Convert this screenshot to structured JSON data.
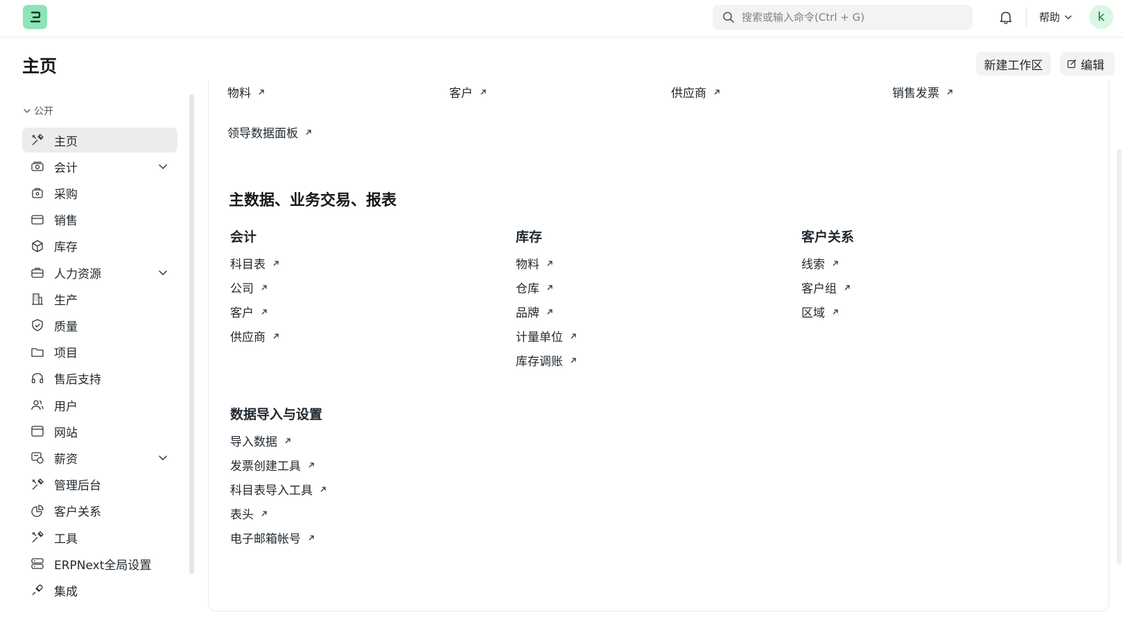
{
  "navbar": {
    "search_placeholder": "搜索或输入命令(Ctrl + G)",
    "help_label": "帮助",
    "avatar_letter": "k"
  },
  "page": {
    "title": "主页",
    "new_workspace_label": "新建工作区",
    "edit_label": "编辑"
  },
  "sidebar": {
    "section_label": "公开",
    "items": [
      {
        "label": "主页",
        "icon": "tools-icon",
        "active": true,
        "expandable": false
      },
      {
        "label": "会计",
        "icon": "money-icon",
        "active": false,
        "expandable": true
      },
      {
        "label": "采购",
        "icon": "purchase-icon",
        "active": false,
        "expandable": false
      },
      {
        "label": "销售",
        "icon": "card-icon",
        "active": false,
        "expandable": false
      },
      {
        "label": "库存",
        "icon": "box-icon",
        "active": false,
        "expandable": false
      },
      {
        "label": "人力资源",
        "icon": "briefcase-icon",
        "active": false,
        "expandable": true
      },
      {
        "label": "生产",
        "icon": "building-icon",
        "active": false,
        "expandable": false
      },
      {
        "label": "质量",
        "icon": "shield-icon",
        "active": false,
        "expandable": false
      },
      {
        "label": "项目",
        "icon": "folder-icon",
        "active": false,
        "expandable": false
      },
      {
        "label": "售后支持",
        "icon": "headset-icon",
        "active": false,
        "expandable": false
      },
      {
        "label": "用户",
        "icon": "users-icon",
        "active": false,
        "expandable": false
      },
      {
        "label": "网站",
        "icon": "browser-icon",
        "active": false,
        "expandable": false
      },
      {
        "label": "薪资",
        "icon": "payroll-icon",
        "active": false,
        "expandable": true
      },
      {
        "label": "管理后台",
        "icon": "tools-icon",
        "active": false,
        "expandable": false
      },
      {
        "label": "客户关系",
        "icon": "pie-icon",
        "active": false,
        "expandable": false
      },
      {
        "label": "工具",
        "icon": "tools-icon",
        "active": false,
        "expandable": false
      },
      {
        "label": "ERPNext全局设置",
        "icon": "settings-db-icon",
        "active": false,
        "expandable": false
      },
      {
        "label": "集成",
        "icon": "plug-icon",
        "active": false,
        "expandable": false
      }
    ]
  },
  "shortcuts": {
    "row": [
      "物料",
      "客户",
      "供应商",
      "销售发票"
    ],
    "extra": "领导数据面板"
  },
  "cards_section": {
    "heading": "主数据、业务交易、报表",
    "columns": [
      {
        "title": "会计",
        "links": [
          "科目表",
          "公司",
          "客户",
          "供应商"
        ]
      },
      {
        "title": "库存",
        "links": [
          "物料",
          "仓库",
          "品牌",
          "计量单位",
          "库存调账"
        ]
      },
      {
        "title": "客户关系",
        "links": [
          "线索",
          "客户组",
          "区域"
        ]
      }
    ],
    "import_card": {
      "title": "数据导入与设置",
      "links": [
        "导入数据",
        "发票创建工具",
        "科目表导入工具",
        "表头",
        "电子邮箱帐号"
      ]
    }
  },
  "colors": {
    "accent_logo": "#8fe3b6",
    "active_bg": "#ececec",
    "text": "#1f272e"
  }
}
